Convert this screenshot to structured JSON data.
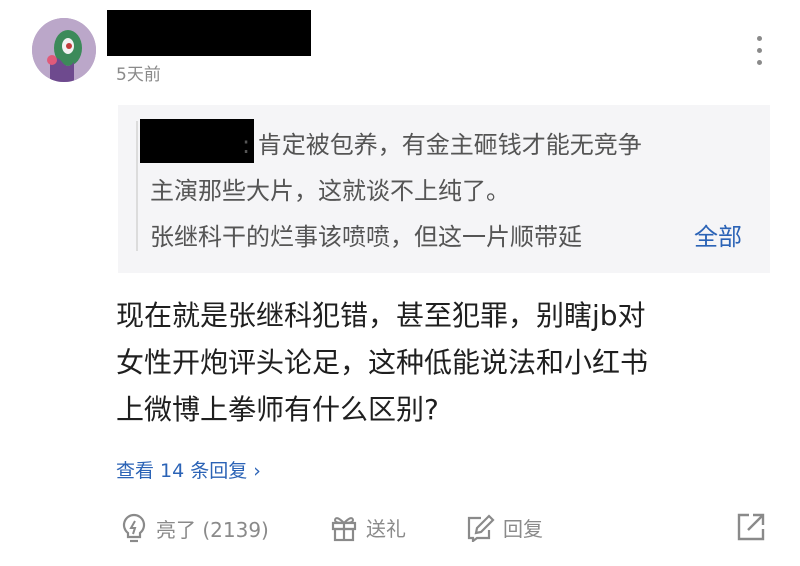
{
  "comment": {
    "time": "5天前",
    "quote": {
      "line1": ": 肯定被包养，有金主砸钱才能无竞争",
      "line2": "主演那些大片，这就谈不上纯了。",
      "line3": "张继科干的烂事该喷喷，但这一片顺带延",
      "expand_label": "全部"
    },
    "body_lines": [
      "现在就是张继科犯错，甚至犯罪，别瞎jb对",
      "女性开炮评头论足，这种低能说法和小红书",
      "上微博上拳师有什么区别?"
    ],
    "replies_label": "查看 14 条回复",
    "replies_chevron": "›"
  },
  "actions": {
    "like_label": "亮了 (2139)",
    "gift_label": "送礼",
    "reply_label": "回复"
  },
  "icons": [
    "avatar",
    "more-icon",
    "lightbulb-icon",
    "gift-icon",
    "reply-edit-icon",
    "share-icon"
  ],
  "colors": {
    "link": "#2b63b6",
    "muted": "#8a8a8a",
    "quote_bg": "#f5f5f7"
  }
}
